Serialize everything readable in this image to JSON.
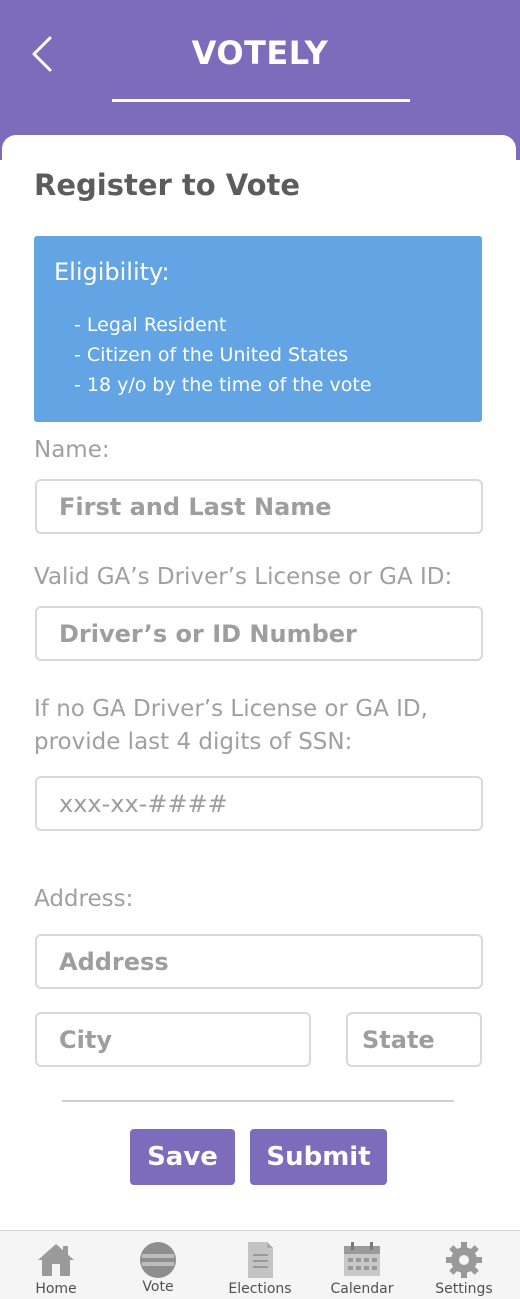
{
  "header": {
    "title": "VOTELY"
  },
  "page": {
    "title": "Register to Vote"
  },
  "eligibility": {
    "heading": "Eligibility:",
    "items": [
      "- Legal Resident",
      "- Citizen of the United States",
      "- 18 y/o by the time of the vote"
    ]
  },
  "form": {
    "name_label": "Name:",
    "name_placeholder": "First and Last Name",
    "license_label": "Valid GA’s Driver’s License or GA ID:",
    "license_placeholder": "Driver’s or ID Number",
    "ssn_label_line1": "If no GA Driver’s License or GA ID,",
    "ssn_label_line2": "provide last 4 digits of SSN:",
    "ssn_placeholder": "xxx-xx-####",
    "address_label": "Address:",
    "address_placeholder": "Address",
    "city_placeholder": "City",
    "state_placeholder": "State"
  },
  "actions": {
    "save": "Save",
    "submit": "Submit"
  },
  "tabbar": {
    "items": [
      {
        "label": "Home",
        "icon": "home-icon"
      },
      {
        "label": "Vote",
        "icon": "vote-icon"
      },
      {
        "label": "Elections",
        "icon": "document-icon"
      },
      {
        "label": "Calendar",
        "icon": "calendar-icon"
      },
      {
        "label": "Settings",
        "icon": "gear-icon"
      }
    ]
  },
  "colors": {
    "brand": "#7d6bbb",
    "eligibility_bg": "#62a4e4"
  }
}
